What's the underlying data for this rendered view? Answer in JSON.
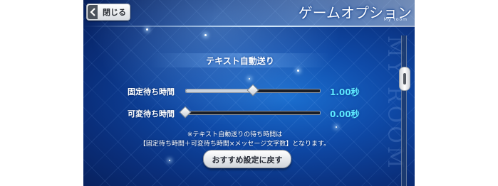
{
  "header": {
    "back_label": "閉じる",
    "title": "ゲームオプション",
    "subtitle": "My room"
  },
  "section": {
    "title": "テキスト自動送り"
  },
  "settings": [
    {
      "label": "固定待ち時間",
      "value_text": "1.00秒",
      "level": 0.5
    },
    {
      "label": "可変待ち時間",
      "value_text": "0.00秒",
      "level": 0.0
    }
  ],
  "note": {
    "line1": "※テキスト自動送りの待ち時間は",
    "line2": "【固定待ち時間＋可変待ち時間×メッセージ文字数】となります。"
  },
  "reset_button": {
    "label": "おすすめ設定に戻す"
  },
  "scrollbar": {
    "position": 0.25
  },
  "colors": {
    "value_text": "#5de9ff",
    "background": "#0f4aa8",
    "button": "#ffffff"
  },
  "icons": {
    "back": "chevron-left-icon"
  }
}
